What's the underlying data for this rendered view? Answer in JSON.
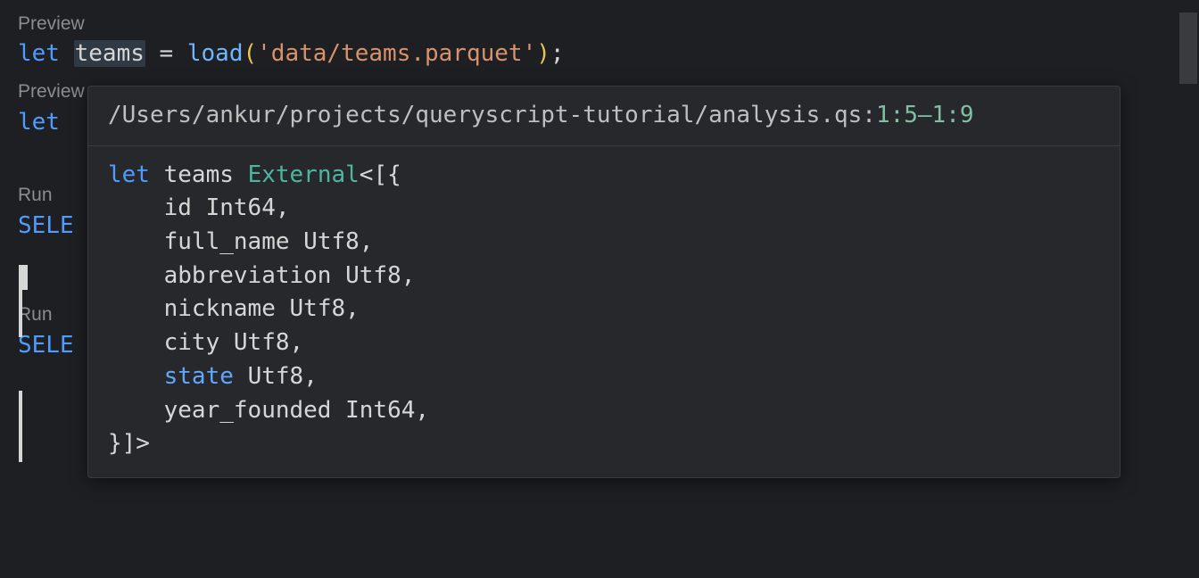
{
  "codelens": {
    "preview": "Preview",
    "run": "Run"
  },
  "line1": {
    "kw": "let",
    "var": "teams",
    "eq": " = ",
    "fn": "load",
    "lp": "(",
    "str": "'data/teams.parquet'",
    "rp": ")",
    "semi": ";"
  },
  "line2": {
    "kw": "let"
  },
  "sel1": "SELE",
  "sel2": "SELE",
  "hover": {
    "path": "/Users/ankur/projects/queryscript-tutorial/analysis.qs:",
    "pos": "1:5–1:9",
    "body": {
      "kw": "let",
      "name": "teams",
      "type": "External",
      "open": "<[{",
      "fields": [
        {
          "name": "id",
          "type": "Int64"
        },
        {
          "name": "full_name",
          "type": "Utf8"
        },
        {
          "name": "abbreviation",
          "type": "Utf8"
        },
        {
          "name": "nickname",
          "type": "Utf8"
        },
        {
          "name": "city",
          "type": "Utf8"
        },
        {
          "name": "state",
          "type": "Utf8",
          "stateKw": true
        },
        {
          "name": "year_founded",
          "type": "Int64"
        }
      ],
      "close": "}]>"
    }
  }
}
